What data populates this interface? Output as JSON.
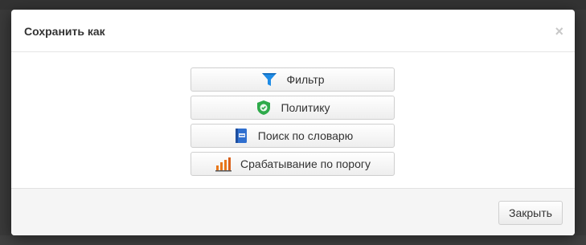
{
  "dialog": {
    "title": "Сохранить как",
    "close_symbol": "×",
    "options": [
      {
        "label": "Фильтр",
        "icon": "filter-icon"
      },
      {
        "label": "Политику",
        "icon": "shield-check-icon"
      },
      {
        "label": "Поиск по словарю",
        "icon": "dictionary-book-icon"
      },
      {
        "label": "Срабатывание по порогу",
        "icon": "threshold-chart-icon"
      }
    ],
    "close_button_label": "Закрыть"
  },
  "colors": {
    "filter": "#1f8ce6",
    "shield": "#2eaa4a",
    "book": "#2f6fcf",
    "bars": "#e8771a"
  }
}
